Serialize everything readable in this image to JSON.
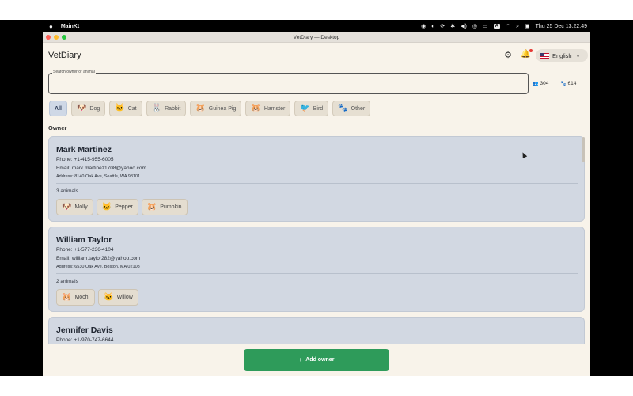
{
  "menubar": {
    "app_name": "MainKt",
    "datetime": "Thu 25 Dec  13:22:49",
    "input_source": "A"
  },
  "window": {
    "title": "VetDiary — Desktop"
  },
  "header": {
    "app_title": "VetDiary",
    "language": "English"
  },
  "search": {
    "label": "Search owner or animal",
    "value": "",
    "owners_count": "304",
    "animals_count": "614"
  },
  "filters": [
    {
      "label": "All",
      "emoji": "",
      "active": true
    },
    {
      "label": "Dog",
      "emoji": "🐶",
      "active": false
    },
    {
      "label": "Cat",
      "emoji": "🐱",
      "active": false
    },
    {
      "label": "Rabbit",
      "emoji": "🐰",
      "active": false
    },
    {
      "label": "Guinea Pig",
      "emoji": "🐹",
      "active": false
    },
    {
      "label": "Hamster",
      "emoji": "🐹",
      "active": false
    },
    {
      "label": "Bird",
      "emoji": "🐦",
      "active": false
    },
    {
      "label": "Other",
      "emoji": "🐾",
      "active": false
    }
  ],
  "section": {
    "owner_heading": "Owner"
  },
  "owners": [
    {
      "name": "Mark Martinez",
      "phone": "Phone: +1-415-955-6005",
      "email": "Email: mark.martinez1708@yahoo.com",
      "address": "Address: 8140 Oak Ave, Seattle, WA 98101",
      "animal_count": "3 animals",
      "animals": [
        {
          "name": "Molly",
          "emoji": "🐶"
        },
        {
          "name": "Pepper",
          "emoji": "🐱"
        },
        {
          "name": "Pumpkin",
          "emoji": "🐹"
        }
      ]
    },
    {
      "name": "William Taylor",
      "phone": "Phone: +1-577-236-4104",
      "email": "Email: william.taylor282@yahoo.com",
      "address": "Address: 6530 Oak Ave, Boston, MA 02108",
      "animal_count": "2 animals",
      "animals": [
        {
          "name": "Mochi",
          "emoji": "🐹"
        },
        {
          "name": "Willow",
          "emoji": "🐱"
        }
      ]
    },
    {
      "name": "Jennifer Davis",
      "phone": "Phone: +1-970-747-6644"
    }
  ],
  "actions": {
    "add_owner": "Add owner"
  }
}
